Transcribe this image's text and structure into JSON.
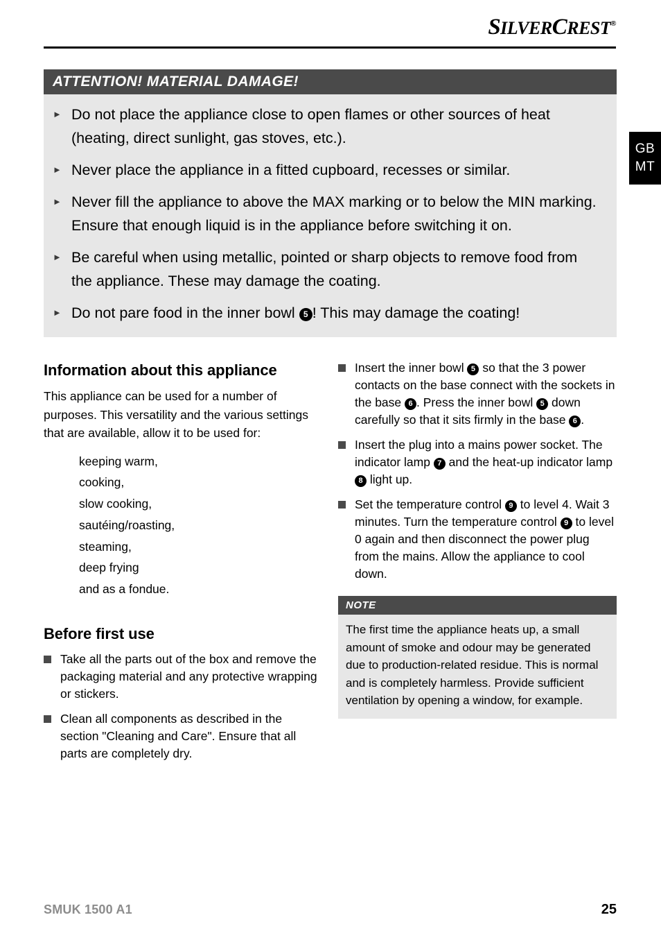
{
  "brand": {
    "name_part1": "S",
    "name_part2": "ILVER",
    "name_part3": "C",
    "name_part4": "REST",
    "registered": "®",
    "full_text": "SILVERCREST®"
  },
  "language_tab": {
    "line1": "GB",
    "line2": "MT"
  },
  "warning": {
    "heading": "ATTENTION! MATERIAL DAMAGE!",
    "marker": "►",
    "items": [
      {
        "text_before": "Do not place the appliance close to open flames or other sources of heat (heating, direct sunlight, gas stoves, etc.).",
        "ref": "",
        "text_after": ""
      },
      {
        "text_before": "Never place the appliance in a fitted cupboard, recesses or similar.",
        "ref": "",
        "text_after": ""
      },
      {
        "text_before": "Never fill the appliance to above the MAX marking or to below the MIN marking. Ensure that enough liquid is in the appliance before switching it on.",
        "ref": "",
        "text_after": ""
      },
      {
        "text_before": "Be careful when using metallic, pointed or sharp objects to remove food from the appliance. These may damage the coating.",
        "ref": "",
        "text_after": ""
      },
      {
        "text_before": "Do not pare food in the inner bowl ",
        "ref": "5",
        "text_after": "! This may damage the coating!"
      }
    ]
  },
  "left_column": {
    "info_heading": "Information about this appliance",
    "info_paragraph": "This appliance can be used for a number of purposes. This versatility and the various settings that are available, allow it to be used for:",
    "uses": [
      "keeping warm,",
      "cooking,",
      "slow cooking,",
      "sautéing/roasting,",
      "steaming,",
      "deep frying",
      "and as a fondue."
    ],
    "before_heading": "Before first use",
    "before_items": [
      "Take all the parts out of the box and remove the packaging material and any protective wrapping or stickers.",
      "Clean all components as described in the section \"Cleaning and Care\". Ensure that all parts are completely dry."
    ]
  },
  "right_column": {
    "steps": [
      {
        "segments": [
          {
            "type": "text",
            "value": "Insert the inner bowl "
          },
          {
            "type": "ref",
            "value": "5"
          },
          {
            "type": "text",
            "value": " so that the 3 power contacts on the base connect with the sockets in the base "
          },
          {
            "type": "ref",
            "value": "6"
          },
          {
            "type": "text",
            "value": ". Press the inner bowl "
          },
          {
            "type": "ref",
            "value": "5"
          },
          {
            "type": "text",
            "value": " down carefully so that it sits firmly in the base "
          },
          {
            "type": "ref",
            "value": "6"
          },
          {
            "type": "text",
            "value": "."
          }
        ]
      },
      {
        "segments": [
          {
            "type": "text",
            "value": "Insert the plug into a mains power socket. The indicator lamp "
          },
          {
            "type": "ref",
            "value": "7"
          },
          {
            "type": "text",
            "value": " and the heat-up indicator lamp "
          },
          {
            "type": "ref",
            "value": "8"
          },
          {
            "type": "text",
            "value": " light up."
          }
        ]
      },
      {
        "segments": [
          {
            "type": "text",
            "value": "Set the temperature control "
          },
          {
            "type": "ref",
            "value": "9"
          },
          {
            "type": "text",
            "value": " to level 4. Wait 3 minutes. Turn the temperature control "
          },
          {
            "type": "ref",
            "value": "9"
          },
          {
            "type": "text",
            "value": " to level 0 again and then disconnect the power plug from the mains. Allow the appliance to cool down."
          }
        ]
      }
    ],
    "note": {
      "heading": "NOTE",
      "body": "The first time the appliance heats up, a small amount of smoke and odour may be generated due to production-related residue. This is normal and is completely harmless. Provide sufficient ventilation by opening a window, for example."
    }
  },
  "footer": {
    "model": "SMUK 1500 A1",
    "page_number": "25"
  },
  "colors": {
    "callout_header_bg": "#4a4a4a",
    "callout_body_bg": "#e7e7e7",
    "tab_bg": "#000000",
    "footer_model_color": "#8c8c8c",
    "bullet_square_color": "#4a4a4a"
  }
}
